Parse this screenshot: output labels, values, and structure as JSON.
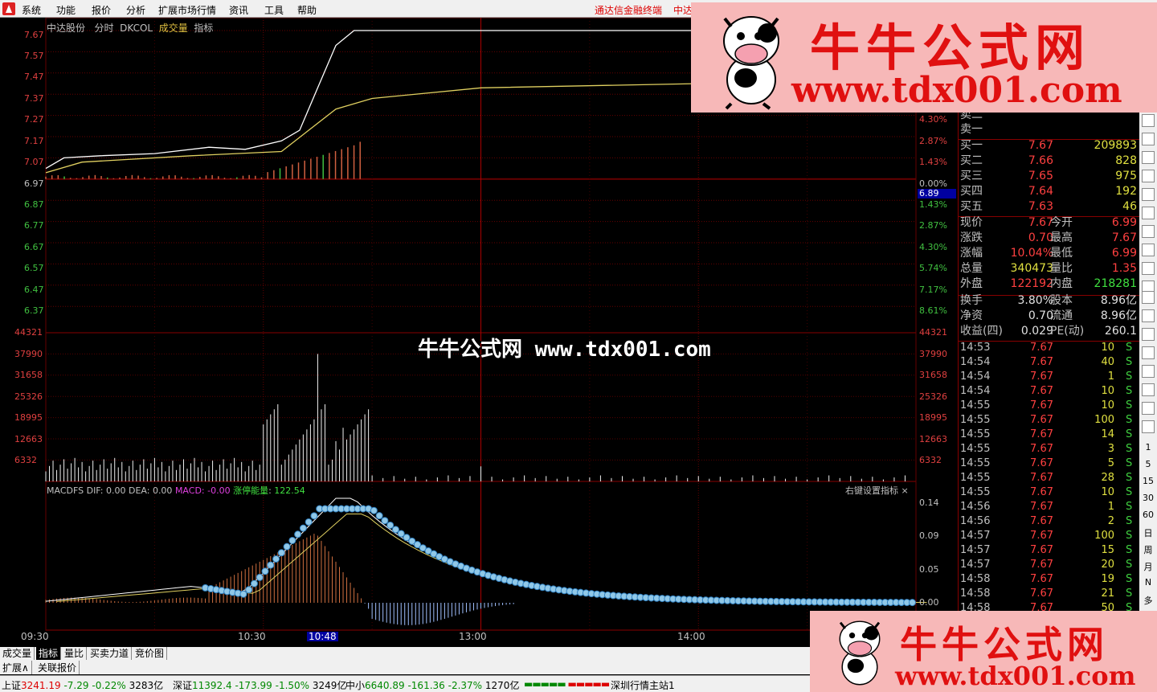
{
  "menu": {
    "items": [
      "系统",
      "功能",
      "报价",
      "分析",
      "扩展市场行情",
      "资讯",
      "工具",
      "帮助"
    ],
    "brand": "通达信金融终端",
    "brand2": "中达"
  },
  "chart_header": {
    "stock": "中达股份",
    "mode": "分时",
    "formula": "DKCOL",
    "volume_label": "成交量",
    "index_label": "指标"
  },
  "price_axis_left": [
    "7.67",
    "7.57",
    "7.47",
    "7.37",
    "7.27",
    "7.17",
    "7.07",
    "6.97",
    "6.87",
    "6.77",
    "6.67",
    "6.57",
    "6.47",
    "6.37"
  ],
  "pct_axis_right": [
    "4.30%",
    "2.87%",
    "1.43%",
    "0.00%",
    "1.43%",
    "2.87%",
    "4.30%",
    "5.74%",
    "7.17%",
    "8.61%"
  ],
  "cursor_price": "6.89",
  "volume_axis": [
    "44321",
    "37990",
    "31658",
    "25326",
    "18995",
    "12663",
    "6332"
  ],
  "macd_header": {
    "name": "MACDFS",
    "dif": "DIF: 0.00",
    "dea": "DEA: 0.00",
    "macd": "MACD: -0.00",
    "energy_label": "涨停能量",
    "energy_value": "122.54"
  },
  "macd_axis": [
    "0.14",
    "0.09",
    "0.05",
    "0.00"
  ],
  "set_indicator": "右键设置指标 ×",
  "time_axis": [
    "09:30",
    "10:30",
    "10:48",
    "13:00",
    "14:00"
  ],
  "watermark": "牛牛公式网 www.tdx001.com",
  "ads": {
    "title": "牛牛公式网",
    "url": "www.tdx001.com"
  },
  "bottom_tabs": [
    "成交量",
    "指标",
    "量比",
    "买卖力道",
    "竞价图"
  ],
  "bottom_tabs2": [
    "扩展∧",
    "关联报价"
  ],
  "status": {
    "sh_name": "上证",
    "sh_val": "3241.19",
    "sh_chg": "-7.29",
    "sh_pct": "-0.22%",
    "sh_amt": "3283亿",
    "sz_name": "深证",
    "sz_val": "11392.4",
    "sz_chg": "-173.99",
    "sz_pct": "-1.50%",
    "sz_amt": "3249亿",
    "zx_name": "中小",
    "zx_val": "6640.89",
    "zx_chg": "-161.36",
    "zx_pct": "-2.37%",
    "zx_amt": "1270亿",
    "server": "深圳行情主站1"
  },
  "quote": {
    "sell_top": [
      "卖二",
      "卖一"
    ],
    "bids": [
      {
        "label": "买一",
        "price": "7.67",
        "vol": "209893"
      },
      {
        "label": "买二",
        "price": "7.66",
        "vol": "828"
      },
      {
        "label": "买三",
        "price": "7.65",
        "vol": "975"
      },
      {
        "label": "买四",
        "price": "7.64",
        "vol": "192"
      },
      {
        "label": "买五",
        "price": "7.63",
        "vol": "46"
      }
    ],
    "stats": [
      {
        "a": "现价",
        "b": "7.67",
        "c": "今开",
        "d": "6.99"
      },
      {
        "a": "涨跌",
        "b": "0.70",
        "c": "最高",
        "d": "7.67"
      },
      {
        "a": "涨幅",
        "b": "10.04%",
        "c": "最低",
        "d": "6.99"
      },
      {
        "a": "总量",
        "b": "340473",
        "c": "量比",
        "d": "1.35",
        "by": true
      },
      {
        "a": "外盘",
        "b": "122192",
        "c": "内盘",
        "d": "218281",
        "dg": true
      }
    ],
    "stats2": [
      {
        "a": "换手",
        "b": "3.80%",
        "c": "股本",
        "d": "8.96亿"
      },
      {
        "a": "净资",
        "b": "0.70",
        "c": "流通",
        "d": "8.96亿"
      },
      {
        "a": "收益(四)",
        "b": "0.029",
        "c": "PE(动)",
        "d": "260.1"
      }
    ]
  },
  "ticks": [
    {
      "t": "14:53",
      "p": "7.67",
      "v": "10",
      "s": "S"
    },
    {
      "t": "14:54",
      "p": "7.67",
      "v": "40",
      "s": "S"
    },
    {
      "t": "14:54",
      "p": "7.67",
      "v": "1",
      "s": "S"
    },
    {
      "t": "14:54",
      "p": "7.67",
      "v": "10",
      "s": "S"
    },
    {
      "t": "14:55",
      "p": "7.67",
      "v": "10",
      "s": "S"
    },
    {
      "t": "14:55",
      "p": "7.67",
      "v": "100",
      "s": "S"
    },
    {
      "t": "14:55",
      "p": "7.67",
      "v": "14",
      "s": "S"
    },
    {
      "t": "14:55",
      "p": "7.67",
      "v": "3",
      "s": "S"
    },
    {
      "t": "14:55",
      "p": "7.67",
      "v": "5",
      "s": "S"
    },
    {
      "t": "14:55",
      "p": "7.67",
      "v": "28",
      "s": "S"
    },
    {
      "t": "14:55",
      "p": "7.67",
      "v": "10",
      "s": "S"
    },
    {
      "t": "14:56",
      "p": "7.67",
      "v": "1",
      "s": "S"
    },
    {
      "t": "14:56",
      "p": "7.67",
      "v": "2",
      "s": "S"
    },
    {
      "t": "14:57",
      "p": "7.67",
      "v": "100",
      "s": "S"
    },
    {
      "t": "14:57",
      "p": "7.67",
      "v": "15",
      "s": "S"
    },
    {
      "t": "14:57",
      "p": "7.67",
      "v": "20",
      "s": "S"
    },
    {
      "t": "14:58",
      "p": "7.67",
      "v": "19",
      "s": "S"
    },
    {
      "t": "14:58",
      "p": "7.67",
      "v": "21",
      "s": "S"
    },
    {
      "t": "14:58",
      "p": "7.67",
      "v": "50",
      "s": "S"
    }
  ],
  "toolbar_text": [
    "1",
    "5",
    "15",
    "30",
    "60",
    "日",
    "周",
    "月",
    "N",
    "多"
  ],
  "chart_data": {
    "type": "line",
    "prev_close": 6.97,
    "ylim": [
      6.37,
      7.67
    ],
    "price_path": [
      [
        0,
        7.02
      ],
      [
        5,
        7.07
      ],
      [
        15,
        7.08
      ],
      [
        30,
        7.09
      ],
      [
        45,
        7.12
      ],
      [
        55,
        7.11
      ],
      [
        65,
        7.15
      ],
      [
        70,
        7.2
      ],
      [
        75,
        7.4
      ],
      [
        80,
        7.6
      ],
      [
        85,
        7.67
      ],
      [
        240,
        7.67
      ]
    ],
    "avg_path": [
      [
        0,
        7.0
      ],
      [
        10,
        7.05
      ],
      [
        40,
        7.08
      ],
      [
        65,
        7.1
      ],
      [
        80,
        7.3
      ],
      [
        90,
        7.35
      ],
      [
        120,
        7.4
      ],
      [
        240,
        7.44
      ]
    ],
    "volume_max": 44321,
    "macd_ylim": [
      0,
      0.14
    ],
    "energy_value": 122.54
  }
}
